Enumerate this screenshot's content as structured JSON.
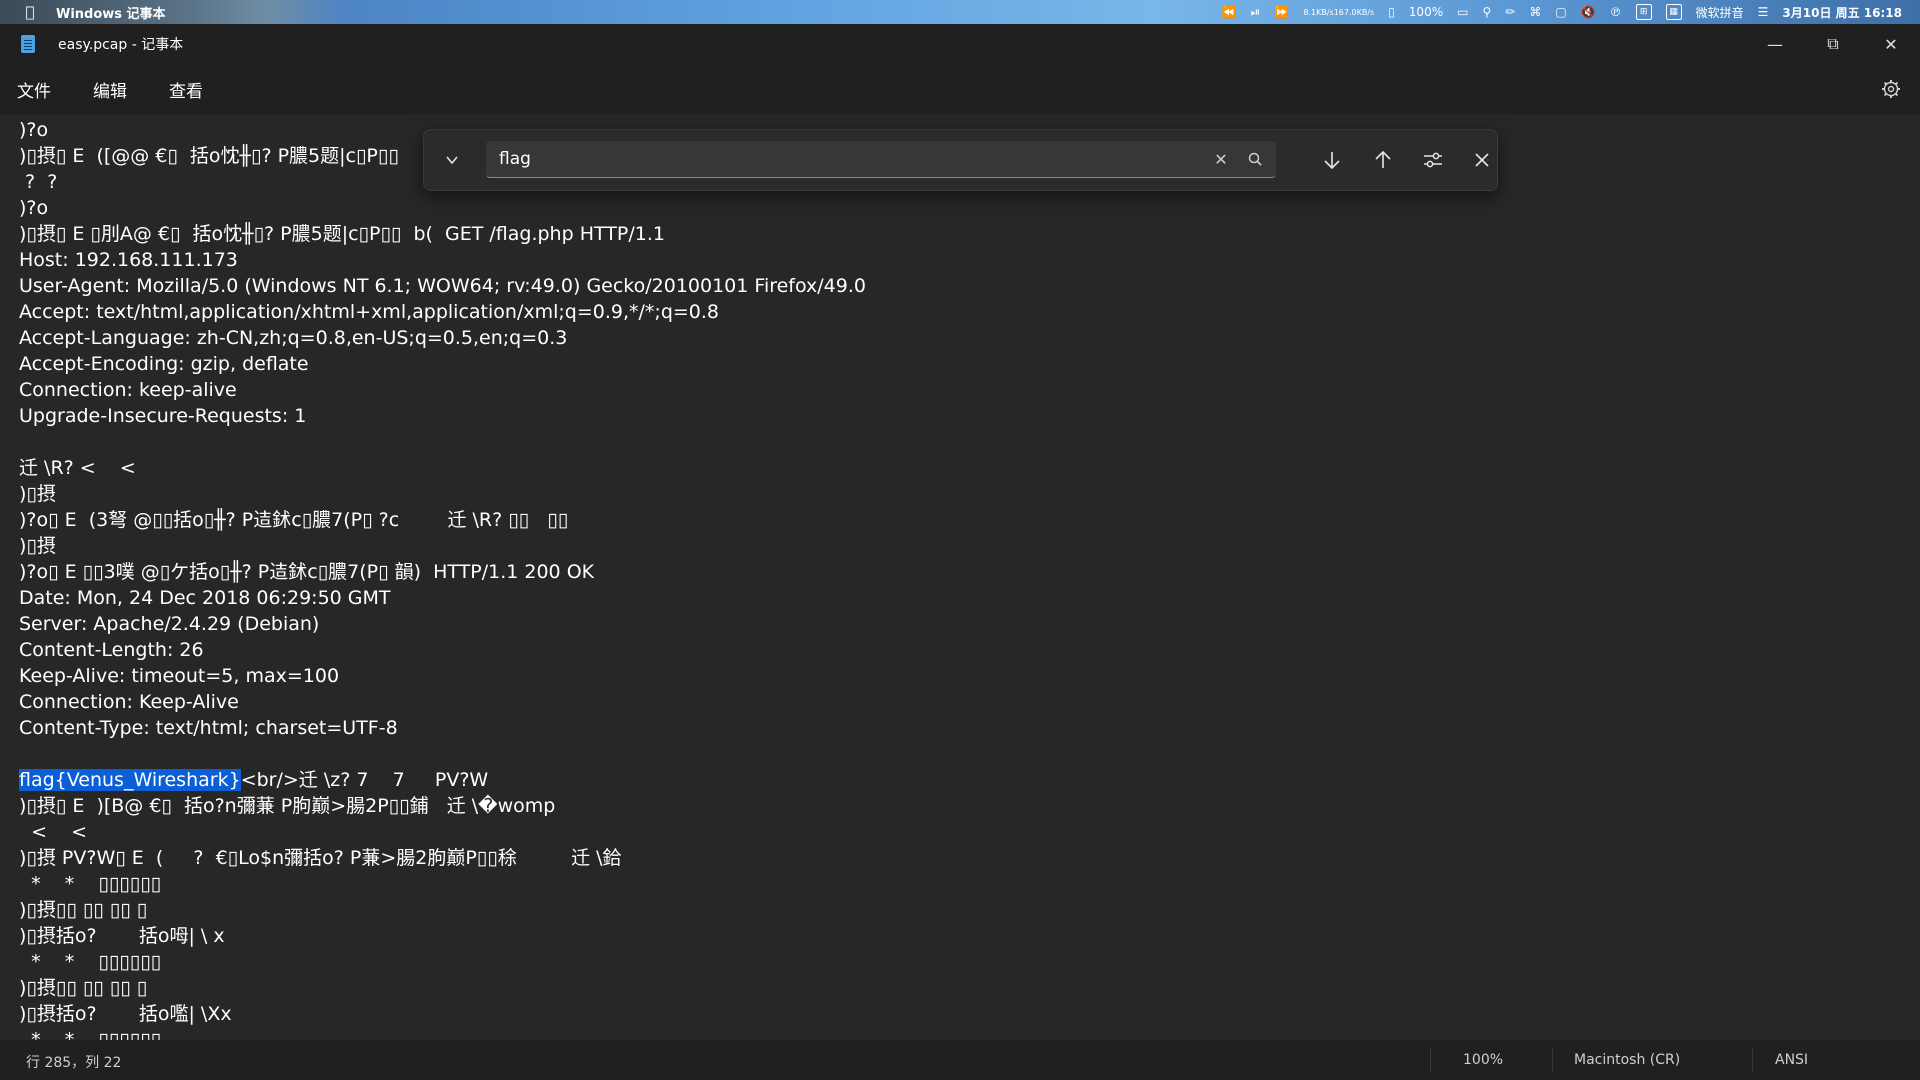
{
  "menubar": {
    "app_name": "Windows 记事本",
    "net_up": "8.1KB/s",
    "net_down": "167.0KB/s",
    "battery": "100%",
    "ime": "微软拼音",
    "datetime": "3月10日 周五 16:18"
  },
  "window": {
    "title": "easy.pcap - 记事本"
  },
  "menu": {
    "file": "文件",
    "edit": "编辑",
    "view": "查看"
  },
  "editor": {
    "lines": [
      ")?o",
      ")▯摂▯ E  ([@@ €▯  括o忱╫▯? P膿5题|c▯P▯▯",
      " ?  ?",
      ")?o",
      ")▯摂▯ E ▯刖A@ €▯  括o忱╫▯? P膿5题|c▯P▯▯  b(  GET /flag.php HTTP/1.1",
      "Host: 192.168.111.173",
      "User-Agent: Mozilla/5.0 (Windows NT 6.1; WOW64; rv:49.0) Gecko/20100101 Firefox/49.0",
      "Accept: text/html,application/xhtml+xml,application/xml;q=0.9,*/*;q=0.8",
      "Accept-Language: zh-CN,zh;q=0.8,en-US;q=0.5,en;q=0.3",
      "Accept-Encoding: gzip, deflate",
      "Connection: keep-alive",
      "Upgrade-Insecure-Requests: 1",
      "",
      "迁 \\R? <    <",
      ")▯摂",
      ")?o▯ E  (3弩 @▯▯括o▯╫? P迼鉥c▯膿7(P▯ ?c        迁 \\R? ▯▯   ▯▯",
      ")▯摂",
      ")?o▯ E ▯▯3噗 @▯ケ括o▯╫? P迼鉥c▯膿7(P▯ 韻)  HTTP/1.1 200 OK",
      "Date: Mon, 24 Dec 2018 06:29:50 GMT",
      "Server: Apache/2.4.29 (Debian)",
      "Content-Length: 26",
      "Keep-Alive: timeout=5, max=100",
      "Connection: Keep-Alive",
      "Content-Type: text/html; charset=UTF-8",
      "",
      "<br/>迁 \\z? 7    7     PV?W",
      ")▯摂▯ E  )[B@ €▯  括o?n彌蒹 P朐巅>腸2P▯▯鋪   迁 \\�womp",
      "  <    <",
      ")▯摂 PV?W▯ E  (     ?  €▯Lo$n彌括o? P蒹>腸2朐巅P▯▯稌         迁 \\鉿",
      "  *    *    ▯▯▯▯▯▯",
      ")▯摂▯▯ ▯▯ ▯▯ ▯",
      ")▯摂括o?       括o呣| \\ x",
      "  *    *    ▯▯▯▯▯▯",
      ")▯摂▯▯ ▯▯ ▯▯ ▯",
      ")▯摂括o?       括o嚂| \\Xx",
      "  *    *    ▯▯▯▯▯▯"
    ],
    "highlight_text": "flag{Venus_Wireshark}",
    "highlight_color": "#0a5fd6"
  },
  "findbar": {
    "query": "flag"
  },
  "status": {
    "position": "行 285，列 22",
    "zoom": "100%",
    "line_ending": "Macintosh (CR)",
    "encoding": "ANSI"
  }
}
